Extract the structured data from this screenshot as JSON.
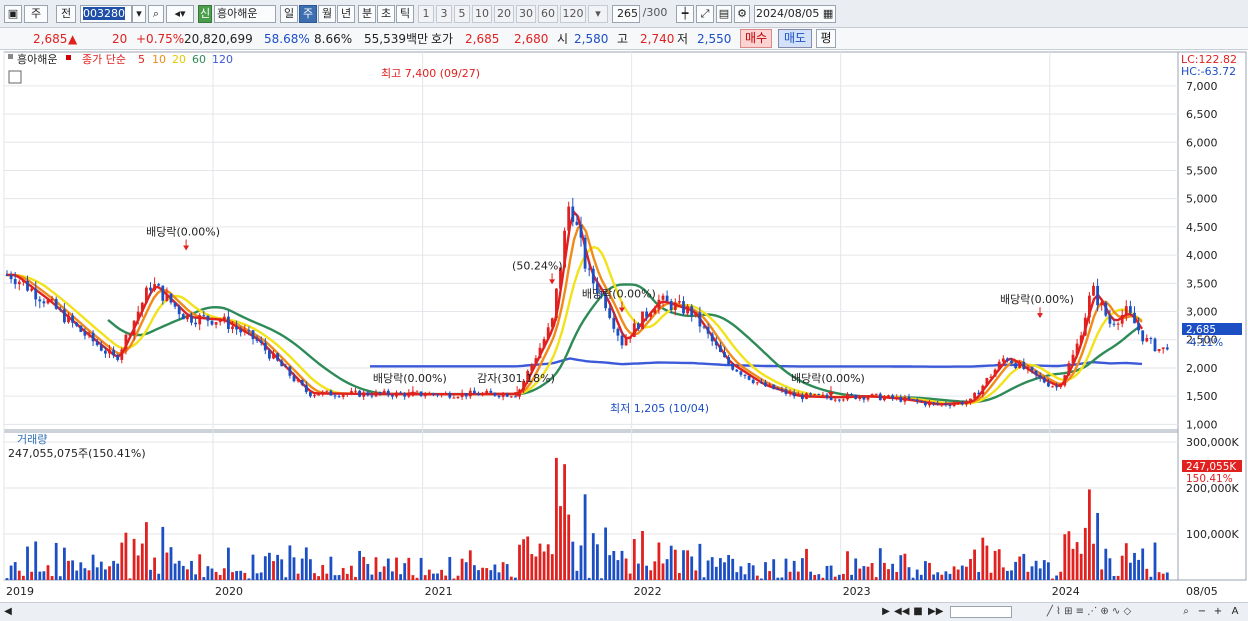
{
  "toolbar": {
    "type_label": "주",
    "prev_label": "전",
    "code_value": "003280",
    "sin_label": "신",
    "stock_name": "흥아해운",
    "period_day": "일",
    "period_week": "주",
    "period_month": "월",
    "period_year": "년",
    "period_minute": "분",
    "period_second": "초",
    "period_tick": "틱",
    "intervals": [
      "1",
      "3",
      "5",
      "10",
      "20",
      "30",
      "60",
      "120"
    ],
    "count_value": "265",
    "count_total": "/300",
    "date_value": "2024/08/05"
  },
  "quote": {
    "price": "2,685",
    "arrow": "▲",
    "change": "20",
    "change_pct": "+0.75%",
    "volume": "20,820,699",
    "pct1": "58.68%",
    "pct2": "8.66%",
    "amount": "55,539백만",
    "hoga_label": "호가",
    "hoga_ask": "2,685",
    "hoga_bid": "2,680",
    "open_label": "시",
    "open": "2,580",
    "high_label": "고",
    "high": "2,740",
    "low_label": "저",
    "low": "2,550",
    "buy_label": "매수",
    "sell_label": "매도",
    "eval_label": "평"
  },
  "legend": {
    "name": "흥아해운",
    "ma_label": "종가 단순",
    "ma_periods": [
      "5",
      "10",
      "20",
      "60",
      "120"
    ]
  },
  "colors": {
    "up": "#e0211f",
    "down": "#1d4fc4",
    "ma5": "#e0211f",
    "ma10": "#f08a18",
    "ma20": "#f2e21a",
    "ma60": "#2e8b57",
    "ma120": "#3b59d9"
  },
  "chart_data": {
    "type": "candlestick",
    "x": [
      "2019-01",
      "2019-03",
      "2019-05",
      "2019-07",
      "2019-09",
      "2019-11",
      "2020-01",
      "2020-03",
      "2020-06",
      "2020-09",
      "2020-12",
      "2021-03",
      "2021-06",
      "2021-08",
      "2021-09",
      "2021-10",
      "2021-11",
      "2021-12",
      "2022-02",
      "2022-04",
      "2022-06",
      "2022-08",
      "2022-10",
      "2022-12",
      "2023-02",
      "2023-04",
      "2023-06",
      "2023-08",
      "2023-10",
      "2023-12",
      "2024-01",
      "2024-02",
      "2024-03",
      "2024-04",
      "2024-05",
      "2024-06",
      "2024-07",
      "2024-08"
    ],
    "close": [
      3650,
      3200,
      2650,
      2150,
      3500,
      2900,
      2850,
      2500,
      1550,
      1540,
      1535,
      1535,
      1540,
      2800,
      5000,
      3700,
      3200,
      2450,
      3200,
      3000,
      2100,
      1700,
      1500,
      1480,
      1500,
      1450,
      1350,
      1400,
      2200,
      1800,
      1650,
      2300,
      3400,
      2800,
      3000,
      2500,
      2300,
      2685
    ],
    "ylim": [
      900,
      7600
    ],
    "yticks": [
      1000,
      1500,
      2000,
      2500,
      3000,
      3500,
      4000,
      4500,
      5000,
      5500,
      6000,
      6500,
      7000
    ],
    "ytick_labels": [
      "1,000",
      "1,500",
      "2,000",
      "2,500",
      "3,000",
      "3,500",
      "4,000",
      "4,500",
      "5,000",
      "5,500",
      "6,000",
      "6,500",
      "7,000"
    ],
    "x_tick_labels": [
      "2019",
      "2020",
      "2021",
      "2022",
      "2023",
      "2024"
    ],
    "x_end_label": "08/05",
    "annotations": [
      {
        "text": "배당락(0.00%)",
        "date": "2019-11",
        "value": 4100
      },
      {
        "text": "배당락(0.00%)",
        "date": "2020-12",
        "value": 1500
      },
      {
        "text": "감자(301.18%)",
        "date": "2021-06",
        "value": 1500
      },
      {
        "text": "(50.24%)",
        "date": "2021-08",
        "value": 3500
      },
      {
        "text": "배당락(0.00%)",
        "date": "2021-12",
        "value": 3000
      },
      {
        "text": "배당락(0.00%)",
        "date": "2022-12",
        "value": 1500
      },
      {
        "text": "배당락(0.00%)",
        "date": "2023-12",
        "value": 2900
      }
    ],
    "high_label": "최고 7,400 (09/27)",
    "low_label": "최저 1,205 (10/04)",
    "lc_label": "LC:122.82",
    "hc_label": "HC:-63.72",
    "last_price_label": "2,685",
    "last_pct_label": "-4.11%",
    "volume_panel": {
      "title": "거래량",
      "info": "247,055,075주(150.41%)",
      "yticks": [
        100000,
        200000,
        300000
      ],
      "ytick_labels": [
        "100,000K",
        "200,000K",
        "300,000K"
      ],
      "ylim": [
        0,
        300000
      ],
      "last_label": "247,055K",
      "last_pct": "150.41%"
    }
  }
}
